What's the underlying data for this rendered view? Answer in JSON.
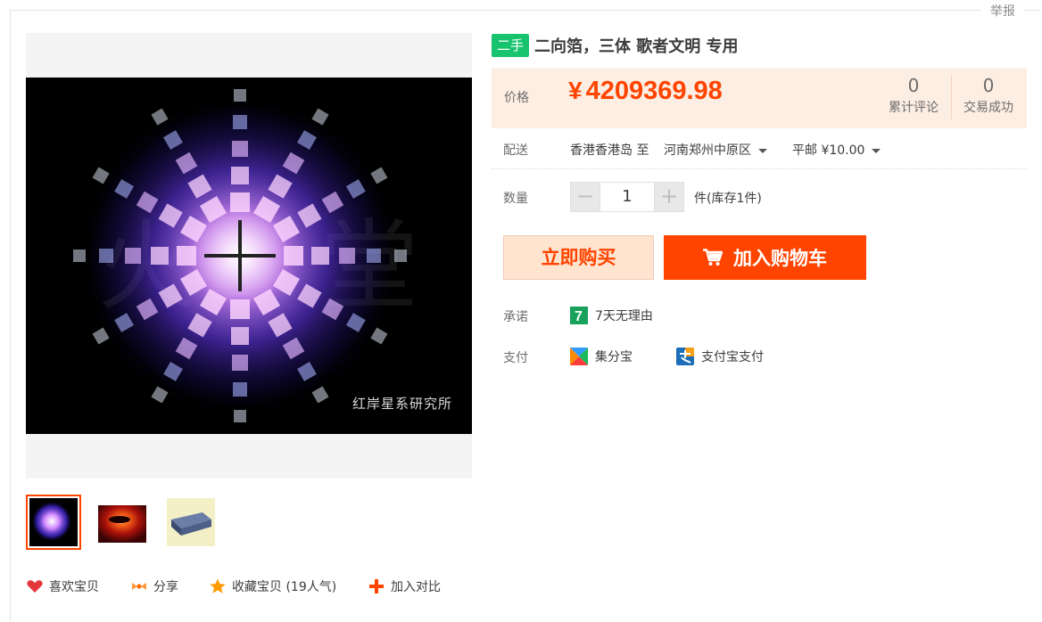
{
  "header": {
    "report_label": "举报"
  },
  "gallery": {
    "watermark": "红岸星系研究所",
    "thumbnails": [
      {
        "name": "firework-thumb",
        "active": true
      },
      {
        "name": "red-disk-thumb",
        "active": false
      },
      {
        "name": "droplet-block-thumb",
        "active": false
      }
    ]
  },
  "actions": {
    "like": "喜欢宝贝",
    "share": "分享",
    "favorite": "收藏宝贝 (19人气)",
    "compare": "加入对比"
  },
  "product": {
    "tag": "二手",
    "title": "二向箔，三体 歌者文明 专用"
  },
  "price": {
    "label": "价格",
    "currency": "¥",
    "value": "4209369.98",
    "reviews_count": "0",
    "reviews_label": "累计评论",
    "deals_count": "0",
    "deals_label": "交易成功"
  },
  "shipping": {
    "label": "配送",
    "from": "香港香港岛 至",
    "to": "河南郑州中原区",
    "fee": "平邮 ¥10.00"
  },
  "quantity": {
    "label": "数量",
    "minus": "−",
    "value": "1",
    "plus": "+",
    "stock": "件(库存1件)"
  },
  "buttons": {
    "buy_now": "立即购买",
    "add_to_cart": "加入购物车"
  },
  "promise": {
    "label": "承诺",
    "icon_text": "7",
    "text": "7天无理由"
  },
  "payment": {
    "label": "支付",
    "methods": [
      "集分宝",
      "支付宝支付"
    ]
  },
  "colors": {
    "accent": "#ff4400",
    "price_bg": "#fdeee3",
    "tag_green": "#17c46d",
    "buy_now_bg": "#ffe4d0"
  }
}
